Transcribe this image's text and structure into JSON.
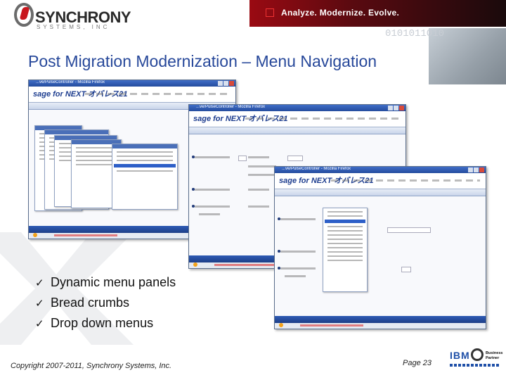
{
  "header": {
    "logo_name": "SYNCHRONY",
    "logo_sub": "SYSTEMS, INC",
    "tagline": "Analyze. Modernize. Evolve.",
    "binary_text": "0101011010"
  },
  "slide": {
    "title": "Post Migration Modernization – Menu Navigation",
    "bullets": [
      {
        "check": "ü",
        "text": "Dynamic menu panels"
      },
      {
        "check": "ü",
        "text": "Bread crumbs"
      },
      {
        "check": "ü",
        "text": "Drop down menus"
      }
    ]
  },
  "screenshots": {
    "app_logo": "sage for NEXT オバレス21"
  },
  "footer": {
    "copyright": "Copyright 2007-2011, Synchrony Systems, Inc.",
    "page": "Page 23",
    "partner_brand": "IBM",
    "partner_label_1": "Business",
    "partner_label_2": "Partner"
  },
  "colors": {
    "title": "#27489a",
    "brand_red": "#c8161d",
    "header_dark": "#5a0a10"
  }
}
